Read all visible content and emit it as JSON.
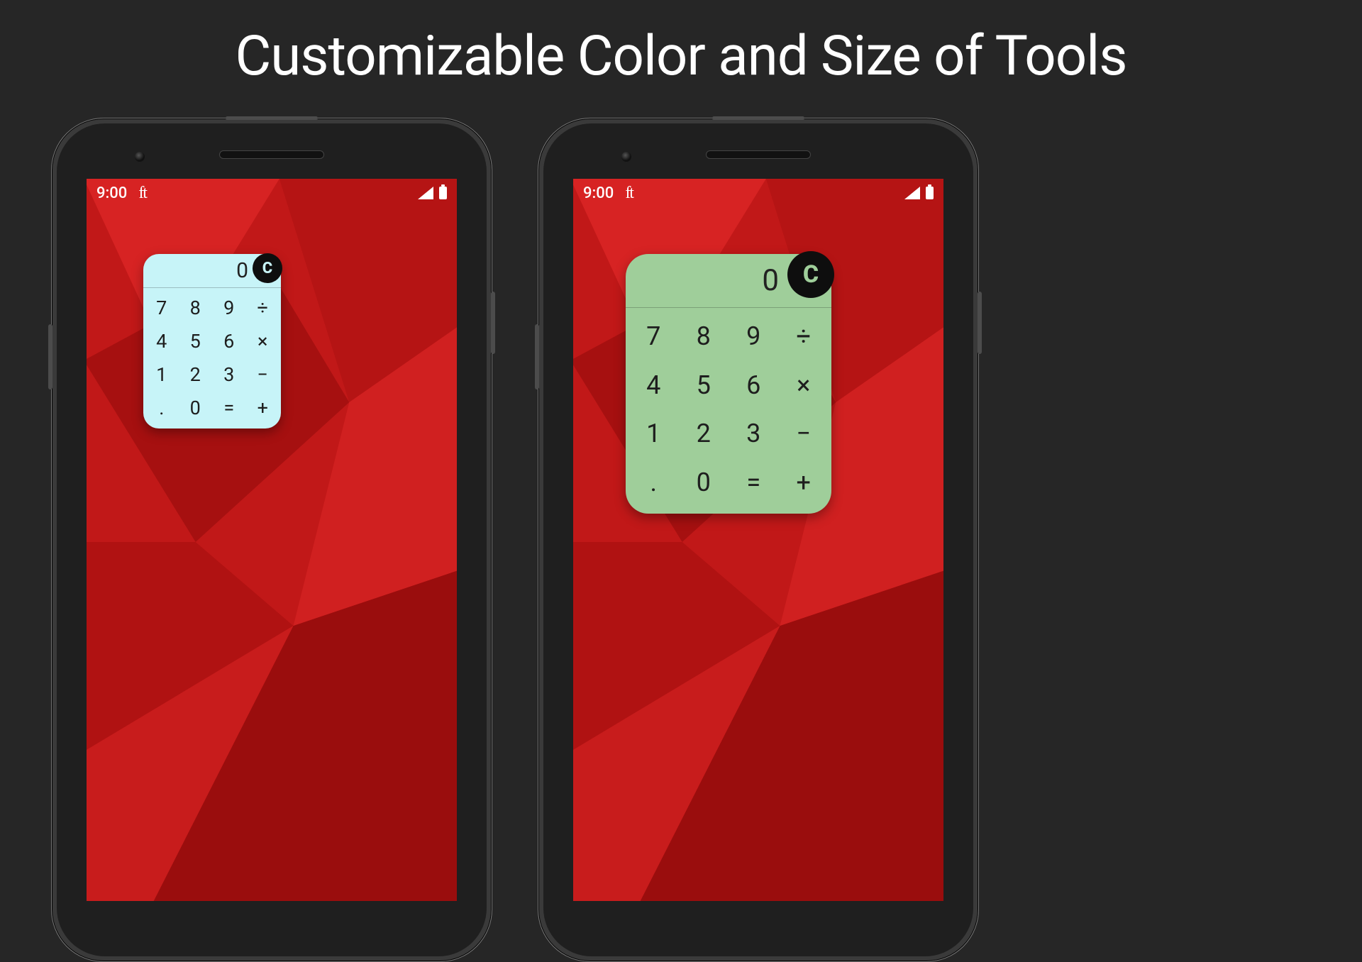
{
  "headline": "Customizable Color and Size of Tools",
  "status": {
    "time": "9:00",
    "carrier_icon": "ft"
  },
  "calculator": {
    "display_value": "0",
    "clear_label": "C",
    "keys": [
      "7",
      "8",
      "9",
      "÷",
      "4",
      "5",
      "6",
      "×",
      "1",
      "2",
      "3",
      "−",
      ".",
      "0",
      "=",
      "+"
    ]
  },
  "variants": {
    "small": {
      "bg": "#c7f4f8",
      "clear_color": "#c7f4f8"
    },
    "large": {
      "bg": "#9fce9a",
      "clear_color": "#9fce9a"
    }
  },
  "wallpaper_palette": {
    "base": "#c11818",
    "dark": "#8e0f0f",
    "mid": "#d72323",
    "light": "#e23a3a"
  }
}
